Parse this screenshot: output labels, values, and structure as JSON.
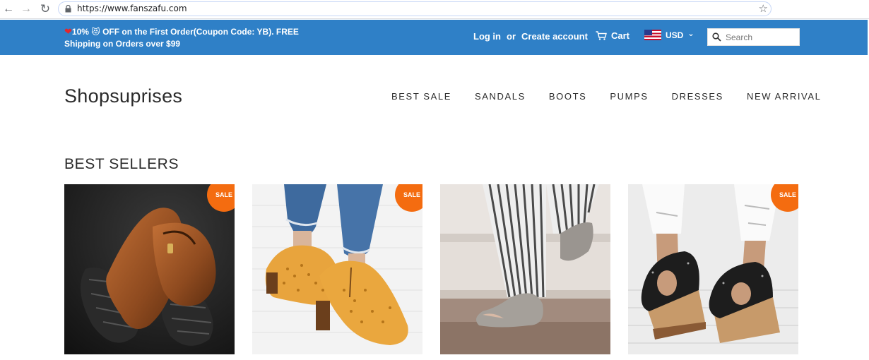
{
  "browser": {
    "url": "https://www.fanszafu.com",
    "back_glyph": "←",
    "forward_glyph": "→",
    "reload_glyph": "↻",
    "star_glyph": "☆"
  },
  "topbar": {
    "promo_line1": "10% 😻 OFF on the First Order(Coupon Code: YB). FREE",
    "promo_line2": "Shipping on Orders over $99",
    "heart": "❤",
    "login": "Log in",
    "or": "or",
    "create_account": "Create account",
    "cart": "Cart",
    "currency": "USD",
    "currency_caret": "⌄",
    "search_placeholder": "Search",
    "colors": {
      "bar": "#2f80c7"
    }
  },
  "header": {
    "logo": "Shopsuprises",
    "nav": [
      "BEST SALE",
      "SANDALS",
      "BOOTS",
      "PUMPS",
      "DRESSES",
      "NEW ARRIVAL"
    ]
  },
  "section": {
    "title": "BEST SELLERS"
  },
  "products": [
    {
      "badge": "SALE",
      "image": "brown-leather-sandal-photo"
    },
    {
      "badge": "SALE",
      "image": "yellow-perforated-bootie-photo"
    },
    {
      "badge": "",
      "image": "grey-open-toe-bootie-photo"
    },
    {
      "badge": "SALE",
      "image": "black-wedge-sandal-photo"
    }
  ],
  "colors": {
    "sale_badge": "#f46c10"
  }
}
